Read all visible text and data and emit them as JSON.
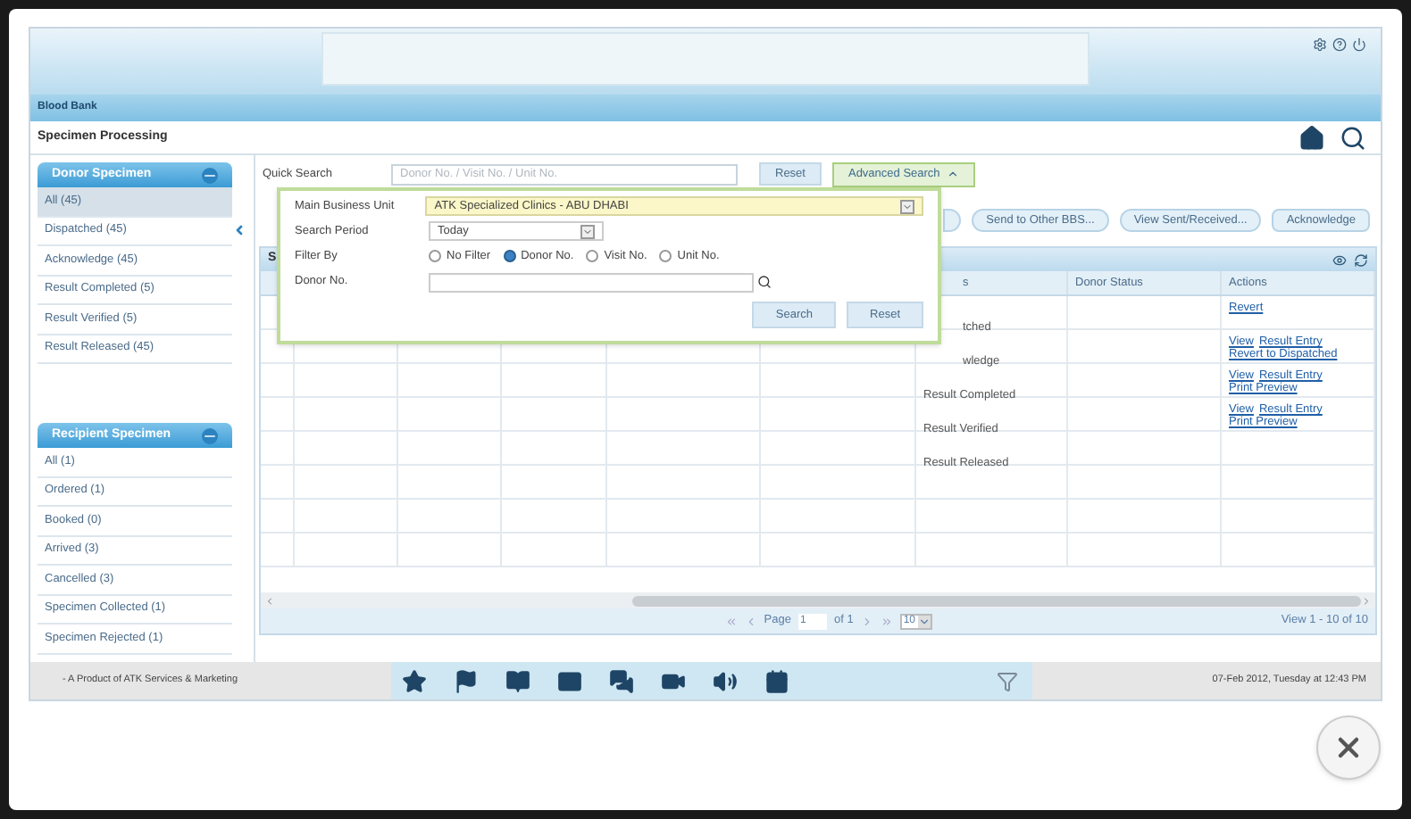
{
  "module_bar": {
    "title": "Blood Bank"
  },
  "page_header": {
    "title": "Specimen Processing"
  },
  "donor_panel": {
    "title": "Donor Specimen",
    "items": [
      {
        "label": "All (45)",
        "selected": true
      },
      {
        "label": "Dispatched (45)",
        "selected": false
      },
      {
        "label": "Acknowledge (45)",
        "selected": false
      },
      {
        "label": "Result Completed (5)",
        "selected": false
      },
      {
        "label": "Result Verified (5)",
        "selected": false
      },
      {
        "label": "Result Released (45)",
        "selected": false
      }
    ]
  },
  "recipient_panel": {
    "title": "Recipient Specimen",
    "items": [
      {
        "label": "All (1)",
        "selected": false
      },
      {
        "label": "Ordered (1)",
        "selected": false
      },
      {
        "label": "Booked (0)",
        "selected": false
      },
      {
        "label": "Arrived (3)",
        "selected": false
      },
      {
        "label": "Cancelled (3)",
        "selected": false
      },
      {
        "label": "Specimen Collected (1)",
        "selected": false
      },
      {
        "label": "Specimen Rejected (1)",
        "selected": false
      }
    ]
  },
  "quick_search": {
    "label": "Quick Search",
    "placeholder": "Donor No. / Visit No. / Unit No.",
    "reset": "Reset",
    "advanced": "Advanced Search"
  },
  "advanced_search": {
    "business_unit_label": "Main Business Unit",
    "business_unit": "ATK Specialized Clinics - ABU DHABI",
    "period_label": "Search Period",
    "period": "Today",
    "filter_label": "Filter By",
    "filters": [
      {
        "label": "No Filter",
        "selected": false
      },
      {
        "label": "Donor No.",
        "selected": true
      },
      {
        "label": "Visit No.",
        "selected": false
      },
      {
        "label": "Unit No.",
        "selected": false
      }
    ],
    "donor_label": "Donor No.",
    "search": "Search",
    "reset": "Reset"
  },
  "action_buttons": [
    "Send to Other BBS...",
    "View Sent/Received...",
    "Acknowledge"
  ],
  "grid": {
    "caption": "S",
    "columns": [
      "",
      "",
      "",
      "",
      "",
      "",
      "s",
      "Donor Status",
      "Actions"
    ],
    "rows": [
      {
        "status": "tched",
        "actions": [
          "Revert"
        ]
      },
      {
        "status": "wledge",
        "actions": [
          "View",
          "Result Entry",
          "Revert to Dispatched"
        ]
      },
      {
        "status": "Result Completed",
        "actions": [
          "View",
          "Result Entry",
          "Print Preview"
        ]
      },
      {
        "status": "Result Verified",
        "actions": [
          "View",
          "Result Entry",
          "Print Preview"
        ]
      },
      {
        "status": "Result Released",
        "actions": []
      },
      {
        "status": "",
        "actions": []
      },
      {
        "status": "",
        "actions": []
      },
      {
        "status": "",
        "actions": []
      }
    ]
  },
  "pager": {
    "page_label": "Page",
    "page": "1",
    "of": "of 1",
    "page_size": "10",
    "summary": "View 1 - 10 of 10"
  },
  "footer": {
    "credit": "- A Product of ATK Services & Marketing",
    "datetime": "07-Feb 2012, Tuesday at 12:43 PM"
  }
}
